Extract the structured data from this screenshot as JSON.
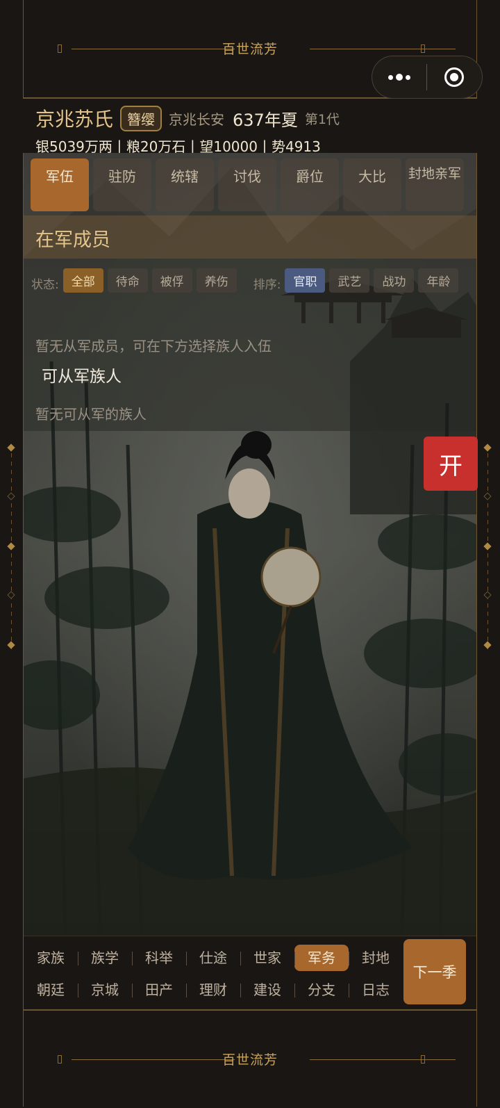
{
  "banner": {
    "title": "百世流芳"
  },
  "capsule": {
    "menu_icon": "more-dots-icon",
    "close_icon": "target-icon"
  },
  "header": {
    "clan_name": "京兆苏氏",
    "rank_badge": "簪缨",
    "location": "京兆长安",
    "year_season": "637年夏",
    "generation": "第1代",
    "resources": "银5039万两丨粮20万石丨望10000丨势4913"
  },
  "tabs": [
    {
      "label": "军伍",
      "active": true
    },
    {
      "label": "驻防"
    },
    {
      "label": "统辖"
    },
    {
      "label": "讨伐"
    },
    {
      "label": "爵位"
    },
    {
      "label": "大比"
    },
    {
      "label": "封地亲军"
    }
  ],
  "section_title": "在军成员",
  "filters": {
    "status_label": "状态:",
    "status_options": [
      "全部",
      "待命",
      "被俘",
      "养伤"
    ],
    "status_selected": "全部",
    "sort_label": "排序:",
    "sort_options": [
      "官职",
      "武艺",
      "战功",
      "年龄"
    ],
    "sort_selected": "官职"
  },
  "empty_members": "暂无从军成员，可在下方选择族人入伍",
  "available_title": "可从军族人",
  "empty_available": "暂无可从军的族人",
  "open_button": "开",
  "bottom_nav": {
    "row1": [
      "家族",
      "族学",
      "科举",
      "仕途",
      "世家",
      "军务",
      "封地"
    ],
    "row2": [
      "朝廷",
      "京城",
      "田产",
      "理财",
      "建设",
      "分支",
      "日志"
    ],
    "active": "军务",
    "next_button": "下一季"
  },
  "colors": {
    "accent": "#a8672c",
    "gold": "#c9a45c",
    "open_red": "#c8302e",
    "background": "#1a1613"
  }
}
